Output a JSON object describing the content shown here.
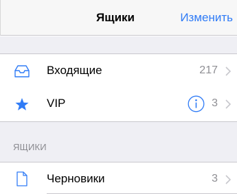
{
  "navbar": {
    "title": "Ящики",
    "edit_label": "Изменить"
  },
  "favorites": [
    {
      "label": "Входящие",
      "count": "217",
      "icon": "inbox-tray-icon"
    },
    {
      "label": "VIP",
      "count": "3",
      "icon": "star-icon",
      "extra_icon": "info-icon"
    }
  ],
  "mailboxes_section": {
    "header": "ЯЩИКИ",
    "items": [
      {
        "label": "Черновики",
        "count": "3",
        "icon": "document-icon"
      }
    ]
  },
  "colors": {
    "accent": "#2f7bf6",
    "group_background": "#efeff4",
    "separator": "#c8c7cc",
    "secondary_text": "#8e8e93"
  }
}
